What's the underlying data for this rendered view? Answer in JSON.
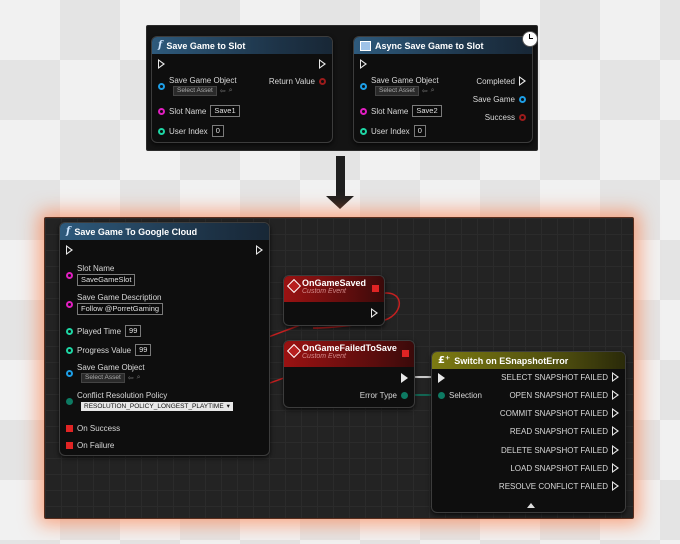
{
  "save_node": {
    "title": "Save Game to Slot",
    "save_game_object": "Save Game Object",
    "select_asset": "Select Asset",
    "return_value": "Return Value",
    "slot_name": "Slot Name",
    "slot_name_value": "Save1",
    "user_index": "User Index",
    "user_index_value": "0"
  },
  "async_node": {
    "title": "Async Save Game to Slot",
    "save_game_object": "Save Game Object",
    "select_asset": "Select Asset",
    "completed": "Completed",
    "save_game": "Save Game",
    "slot_name": "Slot Name",
    "slot_name_value": "Save2",
    "success": "Success",
    "user_index": "User Index",
    "user_index_value": "0"
  },
  "cloud_node": {
    "title": "Save Game To Google Cloud",
    "slot_name": "Slot Name",
    "slot_name_value": "SaveGameSlot",
    "save_desc": "Save Game Description",
    "save_desc_value": "Follow @PorretGaming",
    "played_time": "Played Time",
    "played_time_value": "99",
    "progress_value": "Progress Value",
    "progress_value_value": "99",
    "save_game_object": "Save Game Object",
    "select_asset": "Select Asset",
    "conflict_policy": "Conflict Resolution Policy",
    "conflict_policy_value": "RESOLUTION_POLICY_LONGEST_PLAYTIME",
    "on_success": "On Success",
    "on_failure": "On Failure"
  },
  "event_saved": {
    "title": "OnGameSaved",
    "subtitle": "Custom Event"
  },
  "event_failed": {
    "title": "OnGameFailedToSave",
    "subtitle": "Custom Event",
    "error_type": "Error Type"
  },
  "switch_node": {
    "title": "Switch on ESnapshotError",
    "selection": "Selection",
    "outputs": [
      "SELECT SNAPSHOT FAILED",
      "OPEN SNAPSHOT FAILED",
      "COMMIT SNAPSHOT FAILED",
      "READ SNAPSHOT FAILED",
      "DELETE SNAPSHOT FAILED",
      "LOAD SNAPSHOT FAILED",
      "RESOLVE CONFLICT FAILED"
    ]
  },
  "icons": [
    "function-icon",
    "async-icon",
    "clock-icon",
    "event-icon",
    "switch-icon",
    "down-arrow-icon"
  ],
  "colors": {
    "object_pin": "#1d9ee6",
    "string_pin": "#e11ec0",
    "int_pin": "#1ed6a4",
    "bool_pin": "#9b1b1b",
    "enum_pin": "#0d7a62",
    "glow": "#ff6e32"
  }
}
